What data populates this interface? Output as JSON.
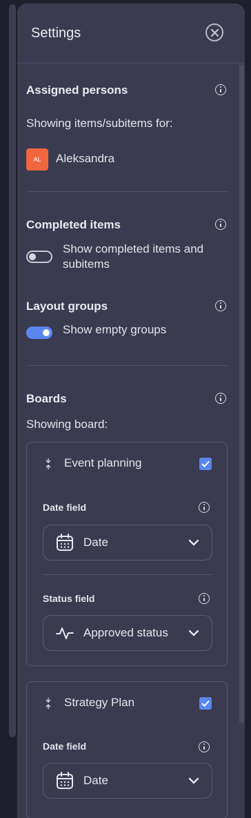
{
  "panel": {
    "title": "Settings"
  },
  "assigned": {
    "title": "Assigned persons",
    "showing_label": "Showing items/subitems for:",
    "person": {
      "initials": "AL",
      "name": "Aleksandra",
      "color": "#f0673f"
    }
  },
  "completed": {
    "title": "Completed items",
    "toggle_label_line1": "Show completed items and",
    "toggle_label_line2": "subitems",
    "enabled": false
  },
  "layout_groups": {
    "title": "Layout groups",
    "toggle_label": "Show empty groups",
    "enabled": true
  },
  "boards": {
    "title": "Boards",
    "showing_label": "Showing board:",
    "items": [
      {
        "name": "Event planning",
        "checked": true,
        "date_field_label": "Date field",
        "date_value": "Date",
        "status_field_label": "Status field",
        "status_value": "Approved status"
      },
      {
        "name": "Strategy Plan",
        "checked": true,
        "date_field_label": "Date field",
        "date_value": "Date"
      }
    ]
  },
  "colors": {
    "accent": "#5b86ef",
    "panel_bg": "#3a3b51",
    "page_bg": "#1f1f2b"
  }
}
